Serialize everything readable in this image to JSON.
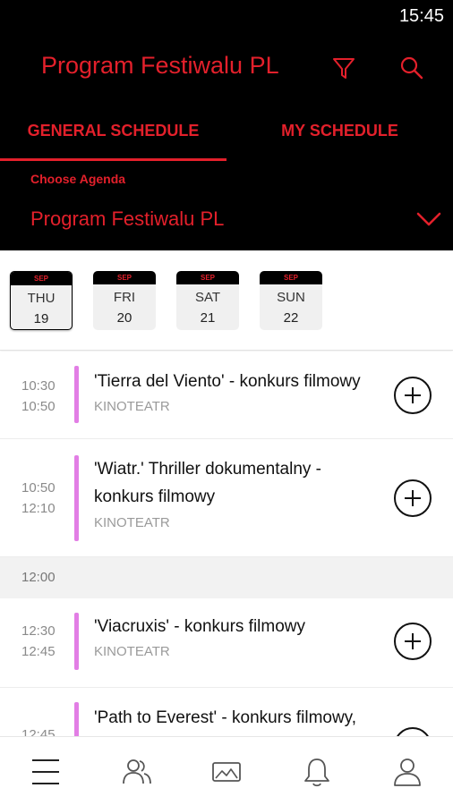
{
  "status_bar": {
    "time": "15:45"
  },
  "header": {
    "title": "Program Festiwalu PL",
    "filter_icon": "filter-icon",
    "search_icon": "search-icon"
  },
  "tabs": [
    {
      "label": "GENERAL SCHEDULE",
      "active": true
    },
    {
      "label": "MY SCHEDULE",
      "active": false
    }
  ],
  "agenda": {
    "caption": "Choose Agenda",
    "selected": "Program Festiwalu PL"
  },
  "days": [
    {
      "month": "SEP",
      "name": "THU",
      "num": "19",
      "selected": true
    },
    {
      "month": "SEP",
      "name": "FRI",
      "num": "20",
      "selected": false
    },
    {
      "month": "SEP",
      "name": "SAT",
      "num": "21",
      "selected": false
    },
    {
      "month": "SEP",
      "name": "SUN",
      "num": "22",
      "selected": false
    }
  ],
  "events": [
    {
      "start": "10:30",
      "end": "10:50",
      "title": "'Tierra del Viento' - konkurs filmowy",
      "venue": "KINOTEATR"
    },
    {
      "start": "10:50",
      "end": "12:10",
      "title": "'Wiatr.' Thriller dokumentalny - konkurs filmowy",
      "venue": "KINOTEATR"
    },
    {
      "start": "12:30",
      "end": "12:45",
      "title": "'Viacruxis' - konkurs filmowy",
      "venue": "KINOTEATR"
    },
    {
      "start": "12:45",
      "end": "",
      "title": "'Path to Everest' - konkurs filmowy,",
      "venue": ""
    }
  ],
  "section_headers": [
    {
      "label": "12:00"
    }
  ],
  "bottom_nav": [
    "menu-icon",
    "people-icon",
    "gallery-icon",
    "bell-icon",
    "profile-icon"
  ],
  "colors": {
    "accent": "#e3202b",
    "event_bar": "#e27ee5",
    "header_bg": "#000000"
  }
}
